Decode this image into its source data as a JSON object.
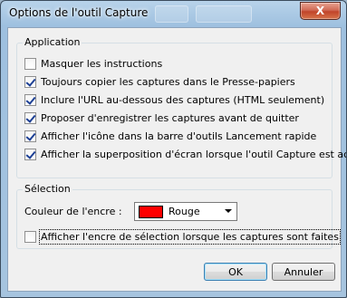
{
  "window": {
    "title": "Options de l'outil Capture",
    "close_glyph": "X"
  },
  "application": {
    "legend": "Application",
    "options": [
      {
        "label": "Masquer les instructions",
        "checked": false
      },
      {
        "label": "Toujours copier les captures dans le Presse-papiers",
        "checked": true
      },
      {
        "label": "Inclure l'URL au-dessous des captures (HTML seulement)",
        "checked": true
      },
      {
        "label": "Proposer d'enregistrer les captures avant de quitter",
        "checked": true
      },
      {
        "label": "Afficher l'icône dans la barre d'outils Lancement rapide",
        "checked": true
      },
      {
        "label": "Afficher la superposition d'écran lorsque l'outil Capture est actif",
        "checked": true
      }
    ]
  },
  "selection": {
    "legend": "Sélection",
    "ink_color_label": "Couleur de l'encre :",
    "ink_color_value": "Rouge",
    "ink_color_hex": "#ff0000",
    "show_ink_label": "Afficher l'encre de sélection lorsque les captures sont faites",
    "show_ink_checked": false
  },
  "buttons": {
    "ok": "OK",
    "cancel": "Annuler"
  }
}
